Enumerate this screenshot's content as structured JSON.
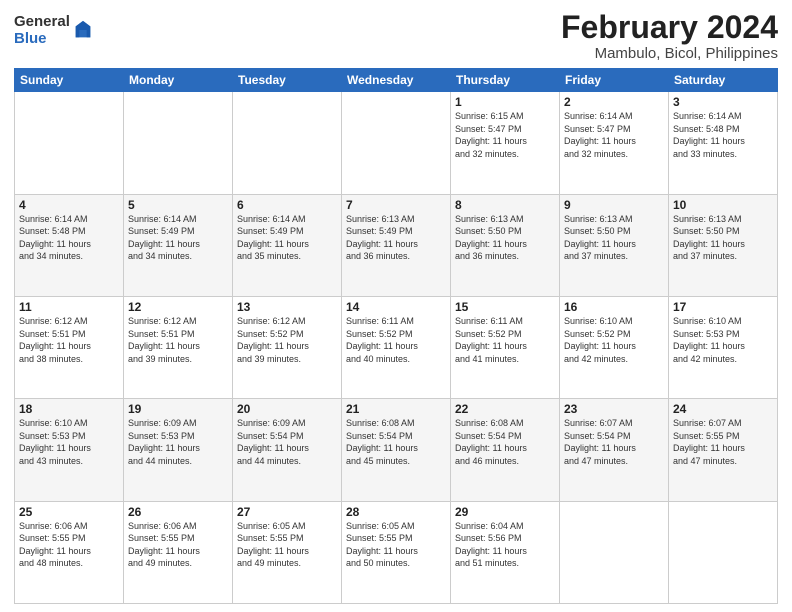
{
  "logo": {
    "general": "General",
    "blue": "Blue"
  },
  "title": {
    "month": "February 2024",
    "location": "Mambulo, Bicol, Philippines"
  },
  "headers": [
    "Sunday",
    "Monday",
    "Tuesday",
    "Wednesday",
    "Thursday",
    "Friday",
    "Saturday"
  ],
  "weeks": [
    [
      {
        "day": "",
        "info": ""
      },
      {
        "day": "",
        "info": ""
      },
      {
        "day": "",
        "info": ""
      },
      {
        "day": "",
        "info": ""
      },
      {
        "day": "1",
        "info": "Sunrise: 6:15 AM\nSunset: 5:47 PM\nDaylight: 11 hours\nand 32 minutes."
      },
      {
        "day": "2",
        "info": "Sunrise: 6:14 AM\nSunset: 5:47 PM\nDaylight: 11 hours\nand 32 minutes."
      },
      {
        "day": "3",
        "info": "Sunrise: 6:14 AM\nSunset: 5:48 PM\nDaylight: 11 hours\nand 33 minutes."
      }
    ],
    [
      {
        "day": "4",
        "info": "Sunrise: 6:14 AM\nSunset: 5:48 PM\nDaylight: 11 hours\nand 34 minutes."
      },
      {
        "day": "5",
        "info": "Sunrise: 6:14 AM\nSunset: 5:49 PM\nDaylight: 11 hours\nand 34 minutes."
      },
      {
        "day": "6",
        "info": "Sunrise: 6:14 AM\nSunset: 5:49 PM\nDaylight: 11 hours\nand 35 minutes."
      },
      {
        "day": "7",
        "info": "Sunrise: 6:13 AM\nSunset: 5:49 PM\nDaylight: 11 hours\nand 36 minutes."
      },
      {
        "day": "8",
        "info": "Sunrise: 6:13 AM\nSunset: 5:50 PM\nDaylight: 11 hours\nand 36 minutes."
      },
      {
        "day": "9",
        "info": "Sunrise: 6:13 AM\nSunset: 5:50 PM\nDaylight: 11 hours\nand 37 minutes."
      },
      {
        "day": "10",
        "info": "Sunrise: 6:13 AM\nSunset: 5:50 PM\nDaylight: 11 hours\nand 37 minutes."
      }
    ],
    [
      {
        "day": "11",
        "info": "Sunrise: 6:12 AM\nSunset: 5:51 PM\nDaylight: 11 hours\nand 38 minutes."
      },
      {
        "day": "12",
        "info": "Sunrise: 6:12 AM\nSunset: 5:51 PM\nDaylight: 11 hours\nand 39 minutes."
      },
      {
        "day": "13",
        "info": "Sunrise: 6:12 AM\nSunset: 5:52 PM\nDaylight: 11 hours\nand 39 minutes."
      },
      {
        "day": "14",
        "info": "Sunrise: 6:11 AM\nSunset: 5:52 PM\nDaylight: 11 hours\nand 40 minutes."
      },
      {
        "day": "15",
        "info": "Sunrise: 6:11 AM\nSunset: 5:52 PM\nDaylight: 11 hours\nand 41 minutes."
      },
      {
        "day": "16",
        "info": "Sunrise: 6:10 AM\nSunset: 5:52 PM\nDaylight: 11 hours\nand 42 minutes."
      },
      {
        "day": "17",
        "info": "Sunrise: 6:10 AM\nSunset: 5:53 PM\nDaylight: 11 hours\nand 42 minutes."
      }
    ],
    [
      {
        "day": "18",
        "info": "Sunrise: 6:10 AM\nSunset: 5:53 PM\nDaylight: 11 hours\nand 43 minutes."
      },
      {
        "day": "19",
        "info": "Sunrise: 6:09 AM\nSunset: 5:53 PM\nDaylight: 11 hours\nand 44 minutes."
      },
      {
        "day": "20",
        "info": "Sunrise: 6:09 AM\nSunset: 5:54 PM\nDaylight: 11 hours\nand 44 minutes."
      },
      {
        "day": "21",
        "info": "Sunrise: 6:08 AM\nSunset: 5:54 PM\nDaylight: 11 hours\nand 45 minutes."
      },
      {
        "day": "22",
        "info": "Sunrise: 6:08 AM\nSunset: 5:54 PM\nDaylight: 11 hours\nand 46 minutes."
      },
      {
        "day": "23",
        "info": "Sunrise: 6:07 AM\nSunset: 5:54 PM\nDaylight: 11 hours\nand 47 minutes."
      },
      {
        "day": "24",
        "info": "Sunrise: 6:07 AM\nSunset: 5:55 PM\nDaylight: 11 hours\nand 47 minutes."
      }
    ],
    [
      {
        "day": "25",
        "info": "Sunrise: 6:06 AM\nSunset: 5:55 PM\nDaylight: 11 hours\nand 48 minutes."
      },
      {
        "day": "26",
        "info": "Sunrise: 6:06 AM\nSunset: 5:55 PM\nDaylight: 11 hours\nand 49 minutes."
      },
      {
        "day": "27",
        "info": "Sunrise: 6:05 AM\nSunset: 5:55 PM\nDaylight: 11 hours\nand 49 minutes."
      },
      {
        "day": "28",
        "info": "Sunrise: 6:05 AM\nSunset: 5:55 PM\nDaylight: 11 hours\nand 50 minutes."
      },
      {
        "day": "29",
        "info": "Sunrise: 6:04 AM\nSunset: 5:56 PM\nDaylight: 11 hours\nand 51 minutes."
      },
      {
        "day": "",
        "info": ""
      },
      {
        "day": "",
        "info": ""
      }
    ]
  ]
}
